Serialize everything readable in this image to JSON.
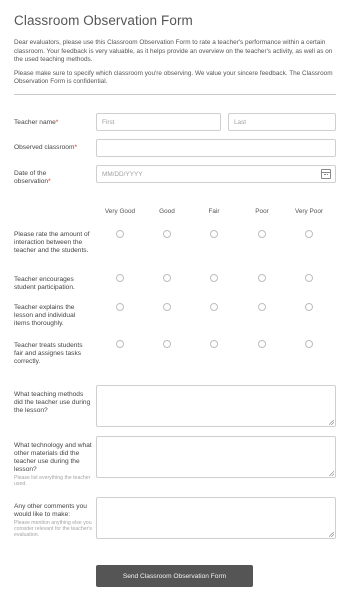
{
  "form": {
    "title": "Classroom Observation Form",
    "intro_1": "Dear evaluators, please use this Classroom Observation Form to rate a teacher's performance within a certain classroom. Your feedback is very valuable, as it helps provide an overview on the teacher's activity, as well as on the used teaching methods.",
    "intro_2": "Please make sure to specify which classroom you're observing. We value your sincere feedback. The Classroom Observation Form is confidential."
  },
  "fields": {
    "teacher_name": {
      "label": "Teacher name",
      "first_placeholder": "First",
      "last_placeholder": "Last"
    },
    "classroom": {
      "label": "Observed classroom",
      "value": ""
    },
    "date": {
      "label": "Date of the observation",
      "placeholder": "MM/DD/YYYY",
      "icon": "calendar-icon"
    }
  },
  "rating": {
    "columns": [
      "Very Good",
      "Good",
      "Fair",
      "Poor",
      "Very Poor"
    ],
    "rows": [
      "Please rate the amount of interaction between the teacher and the students.",
      "Teacher encourages student participation.",
      "Teacher explains the lesson and individual items thoroughly.",
      "Teacher treats students fair and assignes tasks correctly."
    ]
  },
  "questions": {
    "methods": {
      "label": "What teaching methods did the teacher use during the lesson?"
    },
    "technology": {
      "label": "What technology and what other materials did the teacher use during the lesson?",
      "hint": "Please list everything the teacher used."
    },
    "comments": {
      "label": "Any other comments you would like to make:",
      "hint": "Please mention anything else you consider relevant for the teacher's evaluation."
    }
  },
  "submit_label": "Send Classroom Observation Form",
  "colors": {
    "required": "#e02b27",
    "button": "#555555"
  }
}
